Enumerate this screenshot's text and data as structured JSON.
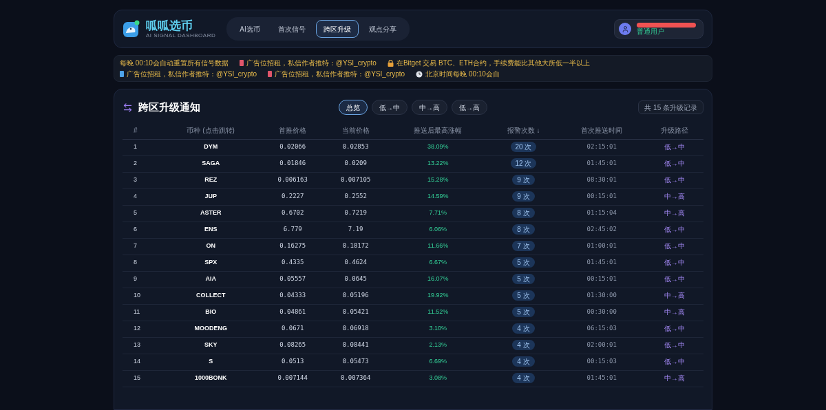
{
  "brand": {
    "name": "呱呱选币",
    "subtitle": "AI SIGNAL DASHBOARD"
  },
  "nav": [
    {
      "label": "AI选币",
      "selected": false
    },
    {
      "label": "首次信号",
      "selected": false
    },
    {
      "label": "跨区升级",
      "selected": true
    },
    {
      "label": "观点分享",
      "selected": false
    }
  ],
  "user": {
    "role": "普通用户"
  },
  "ticker": [
    {
      "kind": "plain",
      "text": "每晚 00:10会自动重置所有信号数据"
    },
    {
      "kind": "red",
      "text": "广告位招租，私信作者推特：@YSI_crypto"
    },
    {
      "kind": "lock",
      "text": "在Bitget 交易 BTC、ETH合约，手续费能比其他大所低一半以上"
    },
    {
      "kind": "blue",
      "text": "广告位招租，私信作者推特：@YSI_crypto"
    },
    {
      "kind": "red",
      "text": "广告位招租，私信作者推特：@YSI_crypto"
    },
    {
      "kind": "clock",
      "text": "北京时间每晚 00:10会自"
    }
  ],
  "panel": {
    "title": "跨区升级通知",
    "filters": [
      {
        "label": "总览",
        "selected": true
      },
      {
        "label": "低→中",
        "selected": false
      },
      {
        "label": "中→高",
        "selected": false
      },
      {
        "label": "低→高",
        "selected": false
      }
    ],
    "record_count": "共 15 条升级记录"
  },
  "table": {
    "columns": [
      "#",
      "币种 (点击跳转)",
      "首推价格",
      "当前价格",
      "推送后最高涨幅",
      "报警次数 ↓",
      "首次推送时间",
      "升级路径"
    ],
    "rows": [
      [
        "1",
        "DYM",
        "0.02066",
        "0.02853",
        "38.09%",
        "20 次",
        "02:15:01",
        "低→中"
      ],
      [
        "2",
        "SAGA",
        "0.01846",
        "0.0209",
        "13.22%",
        "12 次",
        "01:45:01",
        "低→中"
      ],
      [
        "3",
        "REZ",
        "0.006163",
        "0.007105",
        "15.28%",
        "9 次",
        "08:30:01",
        "低→中"
      ],
      [
        "4",
        "JUP",
        "0.2227",
        "0.2552",
        "14.59%",
        "9 次",
        "00:15:01",
        "中→高"
      ],
      [
        "5",
        "ASTER",
        "0.6702",
        "0.7219",
        "7.71%",
        "8 次",
        "01:15:04",
        "中→高"
      ],
      [
        "6",
        "ENS",
        "6.779",
        "7.19",
        "6.06%",
        "8 次",
        "02:45:02",
        "低→中"
      ],
      [
        "7",
        "ON",
        "0.16275",
        "0.18172",
        "11.66%",
        "7 次",
        "01:00:01",
        "低→中"
      ],
      [
        "8",
        "SPX",
        "0.4335",
        "0.4624",
        "6.67%",
        "5 次",
        "01:45:01",
        "低→中"
      ],
      [
        "9",
        "AIA",
        "0.05557",
        "0.0645",
        "16.07%",
        "5 次",
        "00:15:01",
        "低→中"
      ],
      [
        "10",
        "COLLECT",
        "0.04333",
        "0.05196",
        "19.92%",
        "5 次",
        "01:30:00",
        "中→高"
      ],
      [
        "11",
        "BIO",
        "0.04861",
        "0.05421",
        "11.52%",
        "5 次",
        "00:30:00",
        "中→高"
      ],
      [
        "12",
        "MOODENG",
        "0.0671",
        "0.06918",
        "3.10%",
        "4 次",
        "06:15:03",
        "低→中"
      ],
      [
        "13",
        "SKY",
        "0.08265",
        "0.08441",
        "2.13%",
        "4 次",
        "02:00:01",
        "低→中"
      ],
      [
        "14",
        "S",
        "0.0513",
        "0.05473",
        "6.69%",
        "4 次",
        "00:15:03",
        "低→中"
      ],
      [
        "15",
        "1000BONK",
        "0.007144",
        "0.007364",
        "3.08%",
        "4 次",
        "01:45:01",
        "中→高"
      ]
    ]
  }
}
